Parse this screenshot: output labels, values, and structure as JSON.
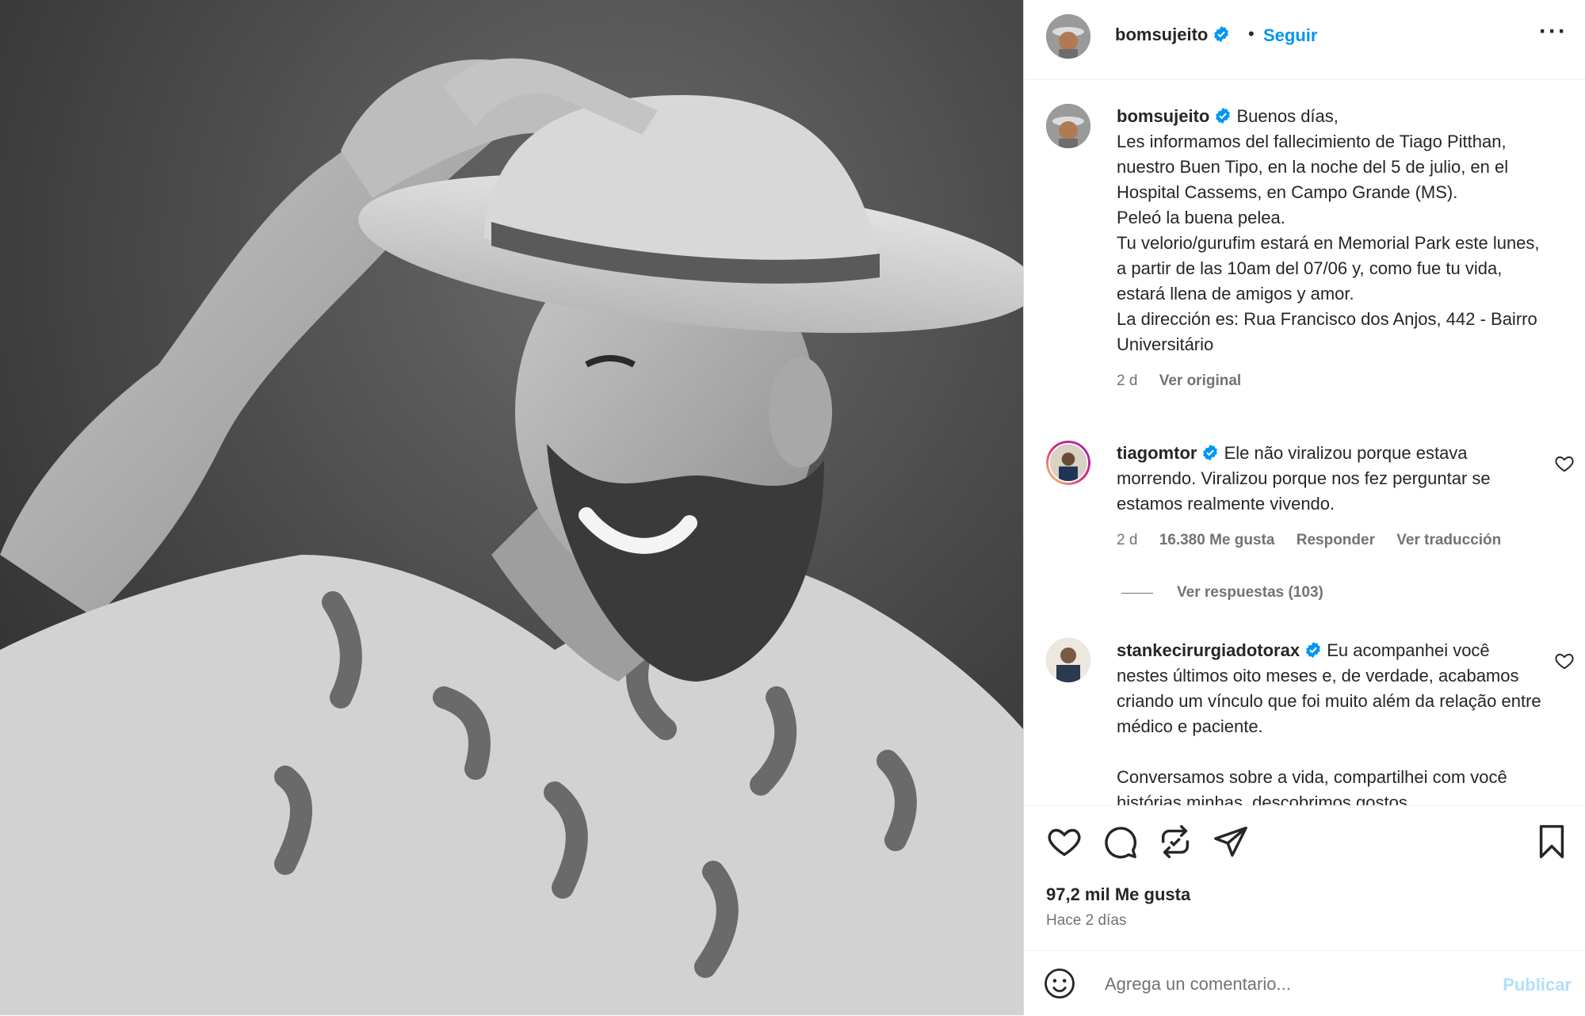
{
  "colors": {
    "accent": "#0095f6",
    "text": "#262626",
    "muted": "#737373",
    "publish_disabled": "#b2dffc",
    "verified": "#0095f6"
  },
  "header": {
    "username": "bomsujeito",
    "separator": "•",
    "follow": "Seguir",
    "more_icon": "ellipsis-icon"
  },
  "caption": {
    "username": "bomsujeito",
    "lines": [
      "Buenos días,",
      "Les informamos del fallecimiento de Tiago Pitthan, nuestro Buen Tipo, en la noche del 5 de julio, en el Hospital Cassems, en Campo Grande (MS).",
      "Peleó la buena pelea.",
      "Tu velorio/gurufim estará en Memorial Park este lunes, a partir de las 10am del 07/06 y, como fue tu vida, estará llena de amigos y amor.",
      "La dirección es: Rua Francisco dos Anjos, 442 - Bairro Universitário"
    ],
    "time": "2 d",
    "see_original": "Ver original"
  },
  "comments": [
    {
      "username": "tiagomtor",
      "text": "Ele não viralizou porque estava morrendo. Viralizou porque nos fez perguntar se estamos realmente vivendo.",
      "time": "2 d",
      "likes": "16.380 Me gusta",
      "reply": "Responder",
      "translate": "Ver traducción",
      "view_replies": "Ver respuestas (103)"
    },
    {
      "username": "stankecirurgiadotorax",
      "text": "Eu acompanhei você nestes últimos oito meses e, de verdade, acabamos criando um vínculo que foi muito além da relação entre médico e paciente.",
      "text2": "Conversamos sobre a vida, compartilhei com você histórias minhas, descobrimos gostos"
    }
  ],
  "actions": {
    "like_icon": "heart-icon",
    "comment_icon": "comment-icon",
    "repost_icon": "repost-icon",
    "share_icon": "send-icon",
    "save_icon": "bookmark-icon"
  },
  "likes_count": "97,2 mil Me gusta",
  "posted": "Hace 2 días",
  "composer": {
    "placeholder": "Agrega un comentario...",
    "publish": "Publicar",
    "emoji_icon": "smiley-icon"
  }
}
